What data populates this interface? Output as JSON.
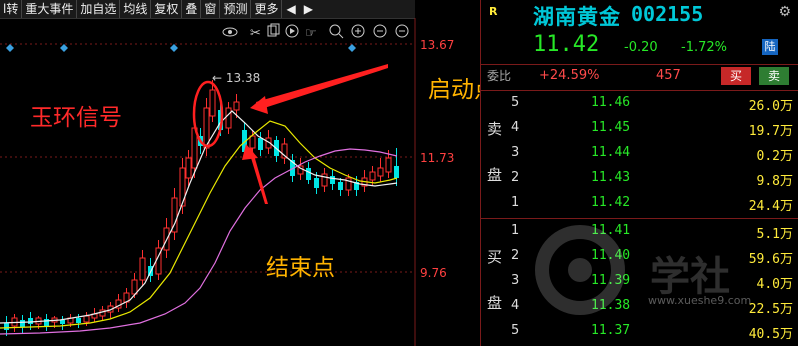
{
  "toolbar": {
    "items": [
      "l转",
      "重大事件",
      "加自选",
      "均线",
      "复权",
      "叠",
      "窗",
      "预测",
      "更多"
    ],
    "arrow_left": "◀",
    "arrow_right": "▶"
  },
  "chart": {
    "y_labels": [
      "13.67",
      "11.73",
      "9.76"
    ],
    "high_label": "13.38",
    "icons": [
      "eye-icon",
      "scissors-icon",
      "copy-icon",
      "play-icon",
      "hand-icon",
      "zoom-icon",
      "zoom-in-icon",
      "zoom-out-icon"
    ]
  },
  "annotations": {
    "jade_signal": "玉环信号",
    "start_point": "启动点",
    "end_point": "结束点"
  },
  "stock": {
    "badge": "R",
    "name": "湖南黄金",
    "code": "002155",
    "price": "11.42",
    "change": "-0.20",
    "change_pct": "-1.72%",
    "exchange_tag": "陆",
    "ratio_label": "委比",
    "ratio": "+24.59%",
    "ratio_diff": "457",
    "buy_label": "买",
    "sell_label": "卖"
  },
  "order_book": {
    "sell_chars": [
      "卖",
      "盘"
    ],
    "buy_chars": [
      "买",
      "盘"
    ],
    "sell": [
      {
        "level": "5",
        "price": "11.46",
        "volume": "26.0万"
      },
      {
        "level": "4",
        "price": "11.45",
        "volume": "19.7万"
      },
      {
        "level": "3",
        "price": "11.44",
        "volume": "0.2万"
      },
      {
        "level": "2",
        "price": "11.43",
        "volume": "9.8万"
      },
      {
        "level": "1",
        "price": "11.42",
        "volume": "24.4万"
      }
    ],
    "buy": [
      {
        "level": "1",
        "price": "11.41",
        "volume": "5.1万"
      },
      {
        "level": "2",
        "price": "11.40",
        "volume": "59.6万"
      },
      {
        "level": "3",
        "price": "11.39",
        "volume": "4.0万"
      },
      {
        "level": "4",
        "price": "11.38",
        "volume": "22.5万"
      },
      {
        "level": "5",
        "price": "11.37",
        "volume": "40.5万"
      }
    ]
  },
  "watermark": {
    "text": "www.xueshe9.com",
    "brand": "学社"
  },
  "colors": {
    "up": "#ff3030",
    "down": "#27e827",
    "accent": "#00c8d8",
    "ma_white": "#f0f0f0",
    "ma_yellow": "#e8e800",
    "ma_magenta": "#e070e0"
  }
}
